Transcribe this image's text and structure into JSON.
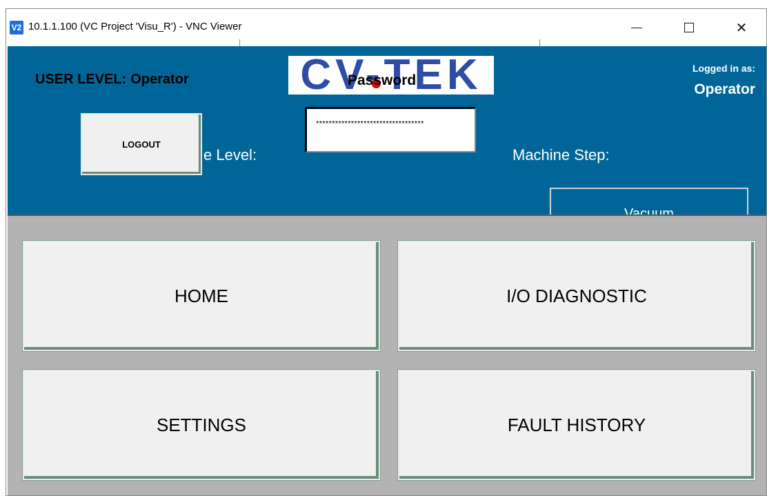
{
  "window": {
    "icon_text": "V2",
    "title": "10.1.1.100 (VC Project 'Visu_R') - VNC Viewer",
    "minimize_glyph": "",
    "maximize_glyph": "",
    "close_glyph": "✕"
  },
  "header": {
    "user_level_label": "USER LEVEL:",
    "user_level_value": "Operator",
    "logo_text": "CV-TEK",
    "password_label": "Password",
    "password_mask": "**********************************",
    "logged_in_label": "Logged in as:",
    "logged_in_value": "Operator",
    "logout_label": "LOGOUT",
    "state_level_label": "e Level:",
    "machine_step_label": "Machine Step:",
    "vacuum_label": "Vacuum"
  },
  "menu": {
    "home": "HOME",
    "io_diagnostic": "I/O DIAGNOSTIC",
    "settings": "SETTINGS",
    "fault_history": "FAULT HISTORY"
  },
  "colors": {
    "hmi_background": "#006699",
    "menu_panel": "#b3b3b3",
    "button_face": "#f0f0f0",
    "logo_blue": "#2d4da6",
    "logo_dot": "#e60000"
  },
  "icons": [
    "vnc-viewer-icon",
    "minimize-icon",
    "maximize-icon",
    "close-icon"
  ]
}
